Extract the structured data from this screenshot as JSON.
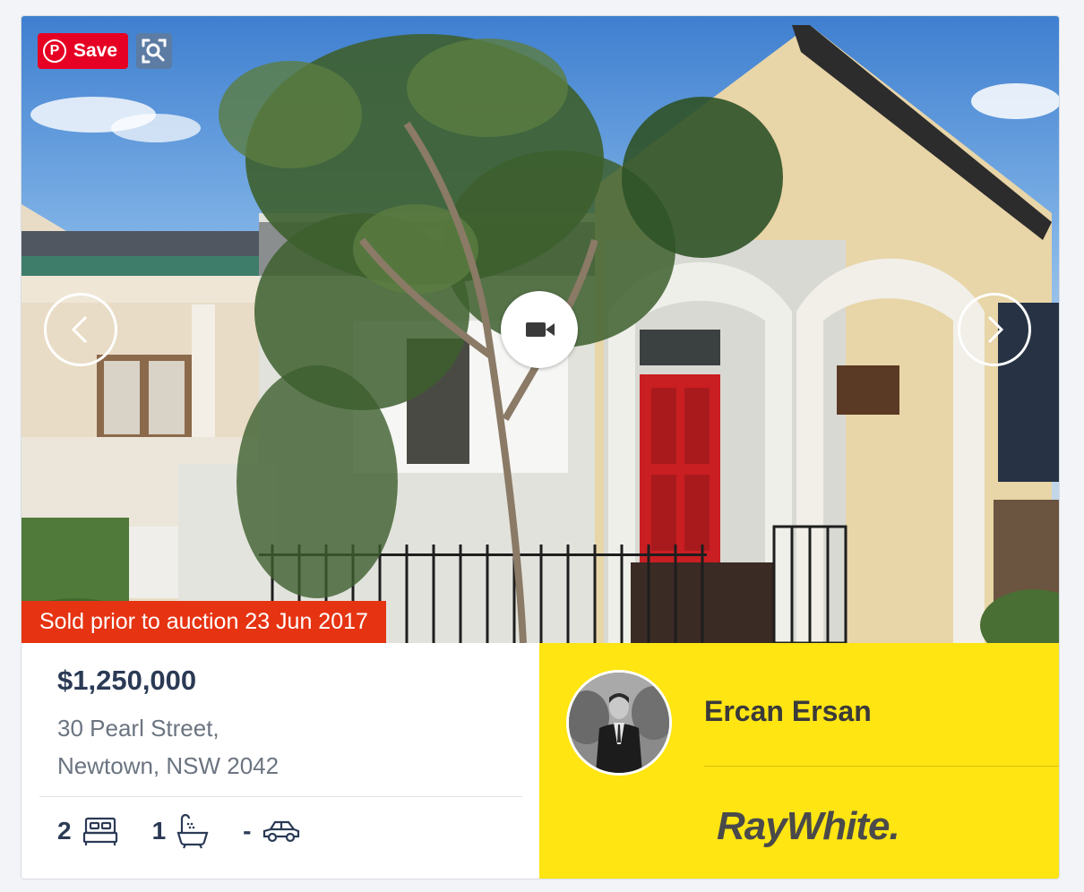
{
  "listing": {
    "status_banner": "Sold prior to auction 23 Jun 2017",
    "price": "$1,250,000",
    "address_line1": "30 Pearl Street,",
    "address_line2": "Newtown, NSW 2042",
    "features": {
      "bedrooms": "2",
      "bathrooms": "1",
      "parking": "-"
    }
  },
  "photo": {
    "save_label": "Save",
    "pinterest_logo": "P"
  },
  "agent": {
    "name": "Ercan Ersan",
    "agency_logo_text": "RayWhite."
  },
  "colors": {
    "sold_banner": "#e63312",
    "agent_panel": "#ffe512",
    "price_text": "#2b3a55",
    "pinterest_red": "#e60023"
  },
  "icons": [
    "pinterest-icon",
    "visual-search-icon",
    "chevron-left-icon",
    "chevron-right-icon",
    "video-camera-icon",
    "bed-icon",
    "bath-icon",
    "car-icon"
  ]
}
